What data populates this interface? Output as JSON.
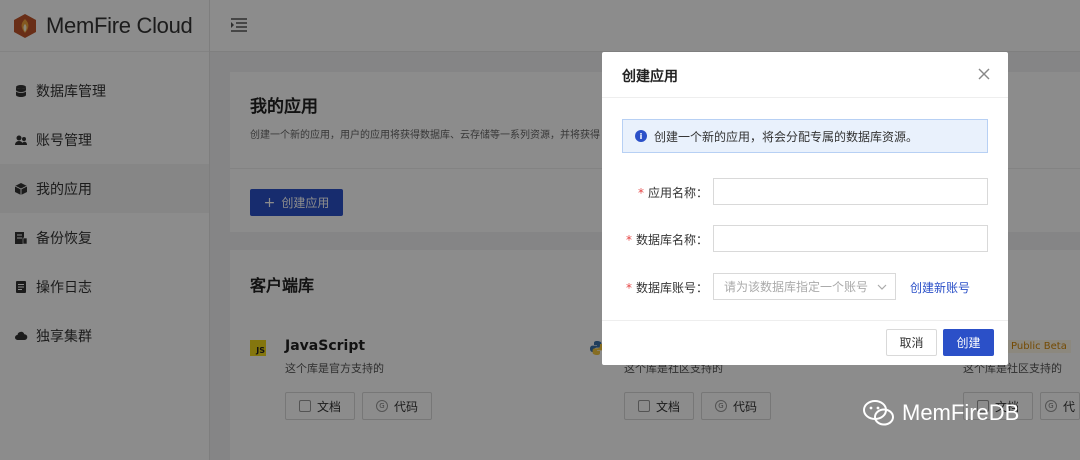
{
  "app": {
    "logo_text": "MemFire Cloud"
  },
  "sidebar": {
    "items": [
      {
        "label": "数据库管理",
        "icon": "database-icon"
      },
      {
        "label": "账号管理",
        "icon": "users-icon"
      },
      {
        "label": "我的应用",
        "icon": "cube-icon",
        "active": true
      },
      {
        "label": "备份恢复",
        "icon": "backup-icon"
      },
      {
        "label": "操作日志",
        "icon": "log-icon"
      },
      {
        "label": "独享集群",
        "icon": "cloud-icon"
      }
    ]
  },
  "page": {
    "title": "我的应用",
    "description": "创建一个新的应用，用户的应用将获得数据库、云存储等一系列资源，并将获得",
    "create_button": "创建应用"
  },
  "client_libs": {
    "title": "客户端库",
    "beta_badge": "Public Beta",
    "items": [
      {
        "name": "JavaScript",
        "subtitle": "这个库是官方支持的",
        "docs_label": "文档",
        "code_label": "代码"
      },
      {
        "name": "",
        "subtitle": "这个库是社区支持的",
        "docs_label": "文档",
        "code_label": "代码"
      },
      {
        "name": "",
        "subtitle": "这个库是社区支持的",
        "docs_label": "文档",
        "code_label": "代"
      }
    ]
  },
  "modal": {
    "title": "创建应用",
    "info": "创建一个新的应用，将会分配专属的数据库资源。",
    "fields": {
      "app_name": {
        "label": "应用名称：",
        "value": ""
      },
      "db_name": {
        "label": "数据库名称：",
        "value": ""
      },
      "db_account": {
        "label": "数据库账号：",
        "placeholder": "请为该数据库指定一个账号"
      }
    },
    "new_account_link": "创建新账号",
    "cancel": "取消",
    "ok": "创建"
  },
  "watermark": {
    "text": "MemFireDB"
  },
  "colors": {
    "primary": "#2b50c8",
    "required": "#e54545",
    "info_bg": "#e9f1fc"
  }
}
